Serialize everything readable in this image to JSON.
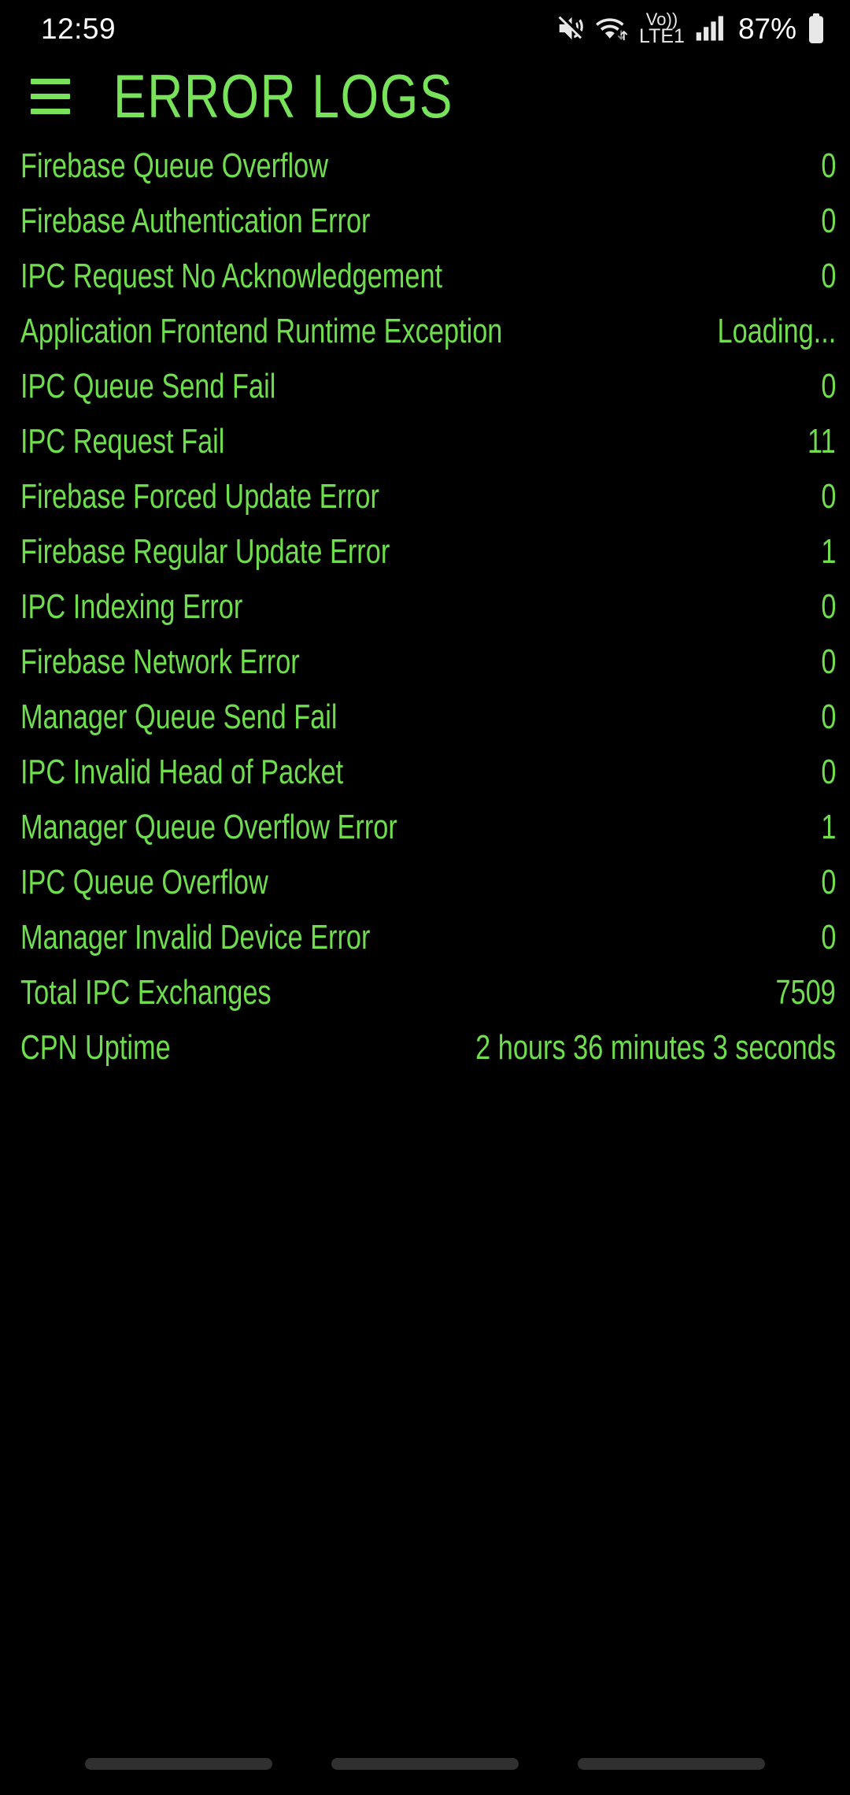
{
  "theme": {
    "background": "#000000",
    "accent_green": "#6fdd4e",
    "title_green": "#78e25a",
    "status_text": "#ffffff",
    "nav_pill": "#303030"
  },
  "status_bar": {
    "time": "12:59",
    "battery_percent": "87%",
    "network_label_top": "Vo))",
    "network_label_bottom": "LTE1",
    "icons": [
      "mute-icon",
      "wifi-icon",
      "volte-icon",
      "signal-bars-icon",
      "battery-icon"
    ]
  },
  "app_bar": {
    "menu_icon": "hamburger-menu-icon",
    "title": "ERROR LOGS"
  },
  "log_list": [
    {
      "label": "Firebase Queue Overflow",
      "value": "0"
    },
    {
      "label": "Firebase Authentication Error",
      "value": "0"
    },
    {
      "label": "IPC Request No Acknowledgement",
      "value": "0"
    },
    {
      "label": "Application Frontend Runtime Exception",
      "value": "Loading..."
    },
    {
      "label": "IPC Queue Send Fail",
      "value": "0"
    },
    {
      "label": "IPC Request Fail",
      "value": "11"
    },
    {
      "label": "Firebase Forced Update Error",
      "value": "0"
    },
    {
      "label": "Firebase Regular Update Error",
      "value": "1"
    },
    {
      "label": "IPC Indexing Error",
      "value": "0"
    },
    {
      "label": "Firebase Network Error",
      "value": "0"
    },
    {
      "label": "Manager Queue Send Fail",
      "value": "0"
    },
    {
      "label": "IPC Invalid Head of Packet",
      "value": "0"
    },
    {
      "label": "Manager Queue Overflow Error",
      "value": "1"
    },
    {
      "label": "IPC Queue Overflow",
      "value": "0"
    },
    {
      "label": "Manager Invalid Device Error",
      "value": "0"
    },
    {
      "label": "Total IPC Exchanges",
      "value": "7509"
    },
    {
      "label": "CPN Uptime",
      "value": "2 hours 36 minutes 3 seconds"
    }
  ],
  "nav_bar": {
    "pills": [
      "recents-pill",
      "home-pill",
      "back-pill"
    ]
  }
}
